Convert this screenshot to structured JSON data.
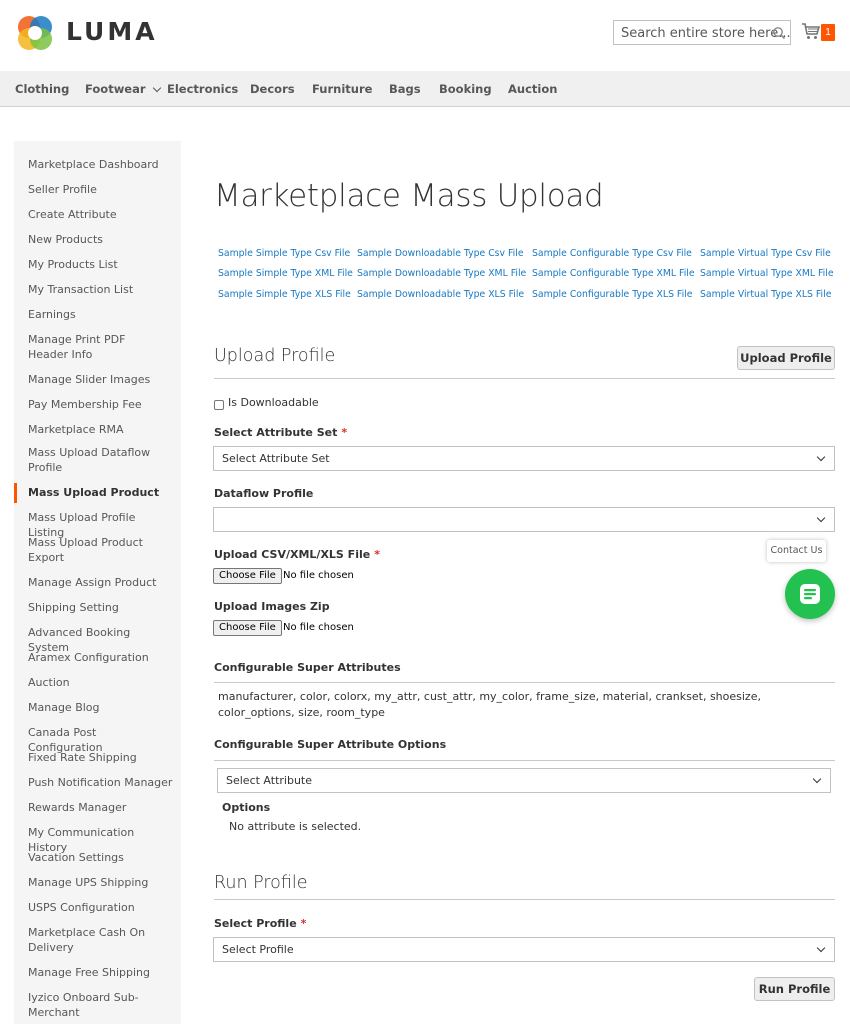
{
  "header": {
    "logo_text": "LUMA",
    "search_placeholder": "Search entire store here...",
    "cart_count": "1"
  },
  "nav": [
    "Clothing",
    "Footwear",
    "Electronics",
    "Decors",
    "Furniture",
    "Bags",
    "Booking",
    "Auction"
  ],
  "sidebar": {
    "items": [
      "Marketplace Dashboard",
      "Seller Profile",
      "Create Attribute",
      "New Products",
      "My Products List",
      "My Transaction List",
      "Earnings",
      "Manage Print PDF Header Info",
      "Manage Slider Images",
      "Pay Membership Fee",
      "Marketplace RMA",
      "Mass Upload Dataflow Profile",
      "Mass Upload Product",
      "Mass Upload Profile Listing",
      "Mass Upload Product Export",
      "Manage Assign Product",
      "Shipping Setting",
      "Advanced Booking System",
      "Aramex Configuration",
      "Auction",
      "Manage Blog",
      "Canada Post Configuration",
      "Fixed Rate Shipping",
      "Push Notification Manager",
      "Rewards Manager",
      "My Communication History",
      "Vacation Settings",
      "Manage UPS Shipping",
      "USPS Configuration",
      "Marketplace Cash On Delivery",
      "Manage Free Shipping",
      "Iyzico Onboard Sub-Merchant"
    ],
    "active_index": 12
  },
  "main": {
    "title": "Marketplace Mass Upload",
    "sample_links": [
      [
        "Sample Simple Type Csv File",
        "Sample Downloadable Type Csv File",
        "Sample Configurable Type Csv File",
        "Sample Virtual Type Csv File"
      ],
      [
        "Sample Simple Type XML File",
        "Sample Downloadable Type XML File",
        "Sample Configurable Type XML File",
        "Sample Virtual Type XML File"
      ],
      [
        "Sample Simple Type XLS File",
        "Sample Downloadable Type XLS File",
        "Sample Configurable Type XLS File",
        "Sample Virtual Type XLS File"
      ]
    ],
    "upload_profile": {
      "title": "Upload Profile",
      "button": "Upload Profile",
      "is_downloadable_label": "Is Downloadable",
      "attribute_set_label": "Select Attribute Set",
      "attribute_set_value": "Select Attribute Set",
      "dataflow_label": "Dataflow Profile",
      "dataflow_value": "",
      "upload_file_label": "Upload CSV/XML/XLS File",
      "choose_file": "Choose File",
      "no_file": "No file chosen",
      "upload_images_label": "Upload Images Zip",
      "super_attrs_label": "Configurable Super Attributes",
      "super_attrs_text": "manufacturer, color, colorx, my_attr, cust_attr, my_color, frame_size, material, crankset, shoesize, color_options, size, room_type",
      "super_attr_options_label": "Configurable Super Attribute Options",
      "select_attribute_value": "Select Attribute",
      "options_label": "Options",
      "options_text": "No attribute is selected."
    },
    "run_profile": {
      "title": "Run Profile",
      "select_label": "Select Profile",
      "select_value": "Select Profile",
      "button": "Run Profile"
    },
    "required_mark": "*"
  },
  "contact": {
    "label": "Contact Us"
  },
  "colors": {
    "accent": "#ff5501",
    "link": "#1979c3",
    "chat": "#23c150",
    "required": "#e02b27"
  }
}
